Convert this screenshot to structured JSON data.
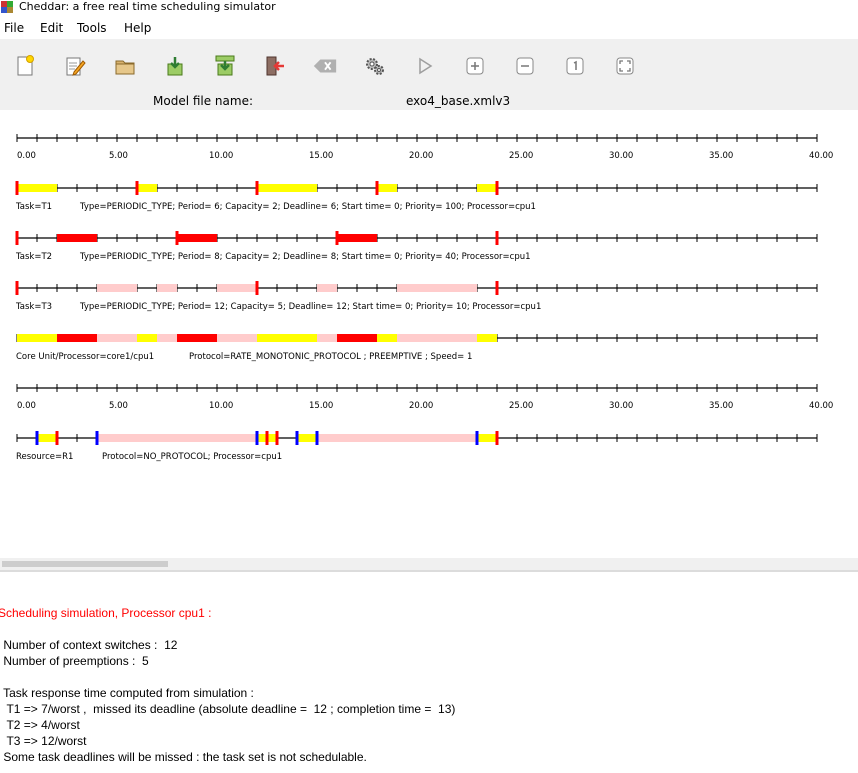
{
  "window": {
    "title": "Cheddar: a free real time scheduling simulator"
  },
  "menu": [
    "File",
    "Edit",
    "Tools",
    "Help"
  ],
  "toolbar": [
    {
      "name": "new-file-icon"
    },
    {
      "name": "edit-icon"
    },
    {
      "name": "open-folder-icon"
    },
    {
      "name": "save-icon"
    },
    {
      "name": "save-as-icon"
    },
    {
      "name": "exit-icon"
    },
    {
      "name": "clear-icon"
    },
    {
      "name": "settings-icon"
    },
    {
      "name": "play-icon"
    },
    {
      "name": "zoom-in-icon"
    },
    {
      "name": "zoom-out-icon"
    },
    {
      "name": "zoom-reset-icon"
    },
    {
      "name": "fit-window-icon"
    }
  ],
  "model": {
    "label": "Model file name:",
    "value": "exo4_base.xmlv3"
  },
  "axis": {
    "labels": [
      "0.00",
      "5.00",
      "10.00",
      "15.00",
      "20.00",
      "25.00",
      "30.00",
      "35.00",
      "40.00"
    ]
  },
  "tasks": [
    {
      "name": "Task=T1",
      "info": "Type=PERIODIC_TYPE; Period= 6; Capacity= 2; Deadline= 6; Start time= 0; Priority= 100; Processor=cpu1"
    },
    {
      "name": "Task=T2",
      "info": "Type=PERIODIC_TYPE; Period= 8; Capacity= 2; Deadline= 8; Start time= 0; Priority= 40; Processor=cpu1"
    },
    {
      "name": "Task=T3",
      "info": "Type=PERIODIC_TYPE; Period= 12; Capacity= 5; Deadline= 12; Start time= 0; Priority= 10; Processor=cpu1"
    }
  ],
  "core": {
    "name": "Core Unit/Processor=core1/cpu1",
    "info": "Protocol=RATE_MONOTONIC_PROTOCOL ; PREEMPTIVE ; Speed= 1"
  },
  "resource": {
    "name": "Resource=R1",
    "info": "Protocol=NO_PROTOCOL; Processor=cpu1"
  },
  "console": {
    "heading": "Scheduling simulation, Processor cpu1 :",
    "lines": [
      " Number of context switches :  12",
      " Number of preemptions :  5",
      " Task response time computed from simulation :",
      "  T1 => 7/worst ,  missed its deadline (absolute deadline =  12 ; completion time =  13)",
      "  T2 => 4/worst",
      "  T3 => 12/worst",
      " Some task deadlines will be missed : the task set is not schedulable."
    ]
  },
  "colors": {
    "yellow": "#ffff00",
    "red": "#ff0000",
    "pink": "#ffcccc",
    "blue": "#0000ff",
    "heading": "#ff0000"
  }
}
